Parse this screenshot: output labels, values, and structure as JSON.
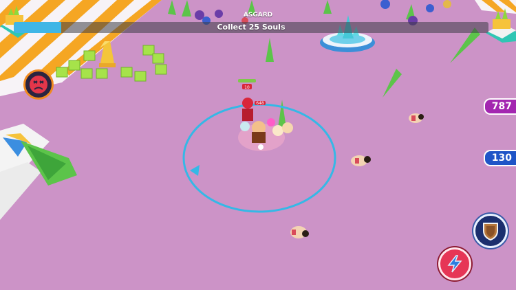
{
  "hud": {
    "zone_name": "ASGARD",
    "objective": "Collect 25 Souls",
    "progress": 0.1
  },
  "counters": {
    "souls": "787",
    "kills": "130"
  },
  "player": {
    "level": "10",
    "enemy_tag": "648"
  },
  "buttons": {
    "ability_left": "angry-face-icon",
    "shield": "shield-icon",
    "lightning": "lightning-icon"
  },
  "colors": {
    "ground": "#cc93c7",
    "progress_fill": "#3fb6e6",
    "souls_pill": "#a326b0",
    "kills_pill": "#1f55c7",
    "range_ring": "#35b8e6"
  }
}
